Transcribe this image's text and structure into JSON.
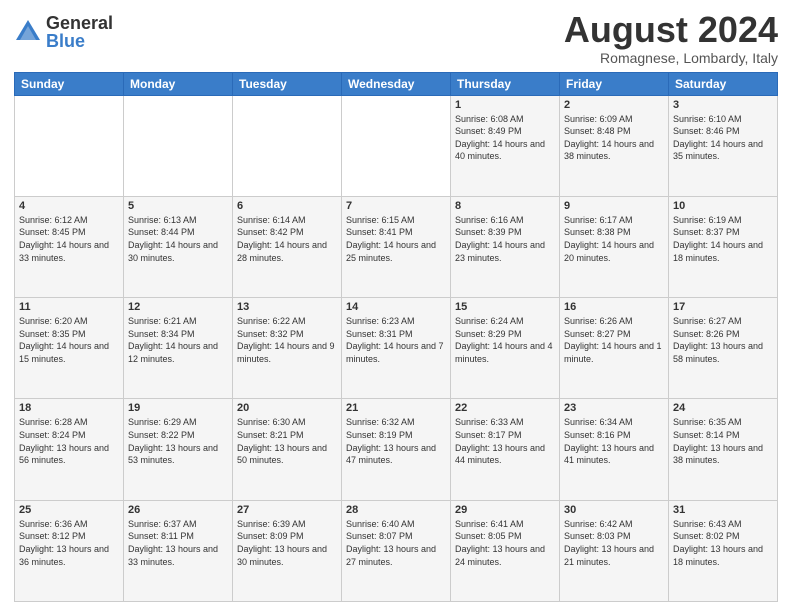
{
  "logo": {
    "general": "General",
    "blue": "Blue"
  },
  "title": "August 2024",
  "location": "Romagnese, Lombardy, Italy",
  "days_of_week": [
    "Sunday",
    "Monday",
    "Tuesday",
    "Wednesday",
    "Thursday",
    "Friday",
    "Saturday"
  ],
  "weeks": [
    [
      {
        "day": "",
        "info": ""
      },
      {
        "day": "",
        "info": ""
      },
      {
        "day": "",
        "info": ""
      },
      {
        "day": "",
        "info": ""
      },
      {
        "day": "1",
        "info": "Sunrise: 6:08 AM\nSunset: 8:49 PM\nDaylight: 14 hours and 40 minutes."
      },
      {
        "day": "2",
        "info": "Sunrise: 6:09 AM\nSunset: 8:48 PM\nDaylight: 14 hours and 38 minutes."
      },
      {
        "day": "3",
        "info": "Sunrise: 6:10 AM\nSunset: 8:46 PM\nDaylight: 14 hours and 35 minutes."
      }
    ],
    [
      {
        "day": "4",
        "info": "Sunrise: 6:12 AM\nSunset: 8:45 PM\nDaylight: 14 hours and 33 minutes."
      },
      {
        "day": "5",
        "info": "Sunrise: 6:13 AM\nSunset: 8:44 PM\nDaylight: 14 hours and 30 minutes."
      },
      {
        "day": "6",
        "info": "Sunrise: 6:14 AM\nSunset: 8:42 PM\nDaylight: 14 hours and 28 minutes."
      },
      {
        "day": "7",
        "info": "Sunrise: 6:15 AM\nSunset: 8:41 PM\nDaylight: 14 hours and 25 minutes."
      },
      {
        "day": "8",
        "info": "Sunrise: 6:16 AM\nSunset: 8:39 PM\nDaylight: 14 hours and 23 minutes."
      },
      {
        "day": "9",
        "info": "Sunrise: 6:17 AM\nSunset: 8:38 PM\nDaylight: 14 hours and 20 minutes."
      },
      {
        "day": "10",
        "info": "Sunrise: 6:19 AM\nSunset: 8:37 PM\nDaylight: 14 hours and 18 minutes."
      }
    ],
    [
      {
        "day": "11",
        "info": "Sunrise: 6:20 AM\nSunset: 8:35 PM\nDaylight: 14 hours and 15 minutes."
      },
      {
        "day": "12",
        "info": "Sunrise: 6:21 AM\nSunset: 8:34 PM\nDaylight: 14 hours and 12 minutes."
      },
      {
        "day": "13",
        "info": "Sunrise: 6:22 AM\nSunset: 8:32 PM\nDaylight: 14 hours and 9 minutes."
      },
      {
        "day": "14",
        "info": "Sunrise: 6:23 AM\nSunset: 8:31 PM\nDaylight: 14 hours and 7 minutes."
      },
      {
        "day": "15",
        "info": "Sunrise: 6:24 AM\nSunset: 8:29 PM\nDaylight: 14 hours and 4 minutes."
      },
      {
        "day": "16",
        "info": "Sunrise: 6:26 AM\nSunset: 8:27 PM\nDaylight: 14 hours and 1 minute."
      },
      {
        "day": "17",
        "info": "Sunrise: 6:27 AM\nSunset: 8:26 PM\nDaylight: 13 hours and 58 minutes."
      }
    ],
    [
      {
        "day": "18",
        "info": "Sunrise: 6:28 AM\nSunset: 8:24 PM\nDaylight: 13 hours and 56 minutes."
      },
      {
        "day": "19",
        "info": "Sunrise: 6:29 AM\nSunset: 8:22 PM\nDaylight: 13 hours and 53 minutes."
      },
      {
        "day": "20",
        "info": "Sunrise: 6:30 AM\nSunset: 8:21 PM\nDaylight: 13 hours and 50 minutes."
      },
      {
        "day": "21",
        "info": "Sunrise: 6:32 AM\nSunset: 8:19 PM\nDaylight: 13 hours and 47 minutes."
      },
      {
        "day": "22",
        "info": "Sunrise: 6:33 AM\nSunset: 8:17 PM\nDaylight: 13 hours and 44 minutes."
      },
      {
        "day": "23",
        "info": "Sunrise: 6:34 AM\nSunset: 8:16 PM\nDaylight: 13 hours and 41 minutes."
      },
      {
        "day": "24",
        "info": "Sunrise: 6:35 AM\nSunset: 8:14 PM\nDaylight: 13 hours and 38 minutes."
      }
    ],
    [
      {
        "day": "25",
        "info": "Sunrise: 6:36 AM\nSunset: 8:12 PM\nDaylight: 13 hours and 36 minutes."
      },
      {
        "day": "26",
        "info": "Sunrise: 6:37 AM\nSunset: 8:11 PM\nDaylight: 13 hours and 33 minutes."
      },
      {
        "day": "27",
        "info": "Sunrise: 6:39 AM\nSunset: 8:09 PM\nDaylight: 13 hours and 30 minutes."
      },
      {
        "day": "28",
        "info": "Sunrise: 6:40 AM\nSunset: 8:07 PM\nDaylight: 13 hours and 27 minutes."
      },
      {
        "day": "29",
        "info": "Sunrise: 6:41 AM\nSunset: 8:05 PM\nDaylight: 13 hours and 24 minutes."
      },
      {
        "day": "30",
        "info": "Sunrise: 6:42 AM\nSunset: 8:03 PM\nDaylight: 13 hours and 21 minutes."
      },
      {
        "day": "31",
        "info": "Sunrise: 6:43 AM\nSunset: 8:02 PM\nDaylight: 13 hours and 18 minutes."
      }
    ]
  ]
}
